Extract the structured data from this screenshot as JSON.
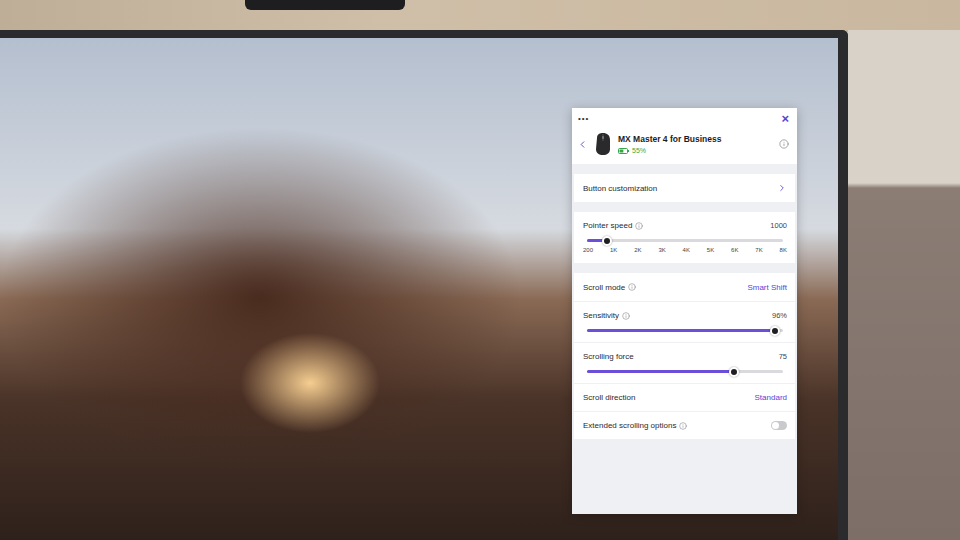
{
  "panel": {
    "menu": "•••",
    "close": "×"
  },
  "device": {
    "name": "MX Master 4 for Business",
    "battery": "55%",
    "battery_level": 0.55
  },
  "sections": [
    {
      "rows": [
        {
          "kind": "link",
          "label": "Button customization",
          "info": false
        }
      ]
    },
    {
      "rows": [
        {
          "kind": "ticks",
          "label": "Pointer speed",
          "info": true,
          "reading": "1000",
          "level": 0.1,
          "ticks": [
            "200",
            "1K",
            "2K",
            "3K",
            "4K",
            "5K",
            "6K",
            "7K",
            "8K"
          ]
        }
      ]
    },
    {
      "rows": [
        {
          "kind": "choice",
          "label": "Scroll mode",
          "info": true,
          "value": "Smart Shift"
        },
        {
          "kind": "slider",
          "label": "Sensitivity",
          "info": true,
          "reading": "96%",
          "level": 0.96
        },
        {
          "kind": "slider",
          "label": "Scrolling force",
          "info": false,
          "reading": "75",
          "level": 0.75
        },
        {
          "kind": "choice",
          "label": "Scroll direction",
          "info": false,
          "value": "Standard"
        },
        {
          "kind": "toggle",
          "label": "Extended scrolling options",
          "info": true,
          "on": false
        }
      ]
    }
  ]
}
